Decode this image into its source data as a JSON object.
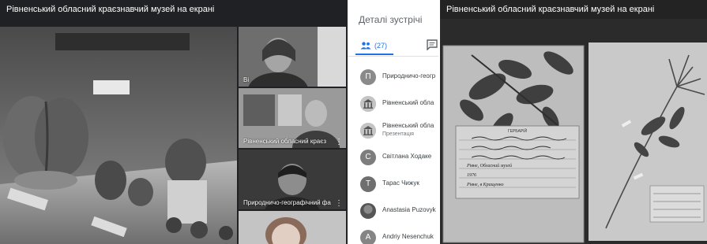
{
  "left_screen": {
    "presentation_title": "Рівненський обласний краєзнавчий музей на екрані",
    "tiles": [
      {
        "name": "Ві"
      },
      {
        "name": "Рівненський обласний краєз"
      },
      {
        "name": "Природничо-географічний фа"
      },
      {
        "name": ""
      }
    ]
  },
  "details_panel": {
    "title": "Деталі зустрічі",
    "people_count": "(27)",
    "people_icon": "people-icon",
    "chat_icon": "chat-icon",
    "participants": [
      {
        "avatar": "П",
        "name": "Природничо-геогр",
        "subtitle": ""
      },
      {
        "avatar": "",
        "name": "Рівненський обла",
        "subtitle": ""
      },
      {
        "avatar": "",
        "name": "Рівненський обла",
        "subtitle": "Презентація"
      },
      {
        "avatar": "С",
        "name": "Світлана Ходаке",
        "subtitle": ""
      },
      {
        "avatar": "Т",
        "name": "Тарас Чижук",
        "subtitle": ""
      },
      {
        "avatar": "",
        "name": "Anastasia Puzovyk",
        "subtitle": ""
      },
      {
        "avatar": "A",
        "name": "Andriy Nesenchuk",
        "subtitle": ""
      }
    ]
  },
  "right_screen": {
    "presentation_title": "Рівненський обласний краєзнавчий музей на екрані",
    "label_text": {
      "header": "ГЕРБАРІЙ",
      "line1": "Рівне, Обласний музей",
      "line2": "1976",
      "line3": "Рівне, в Кращенко"
    }
  }
}
